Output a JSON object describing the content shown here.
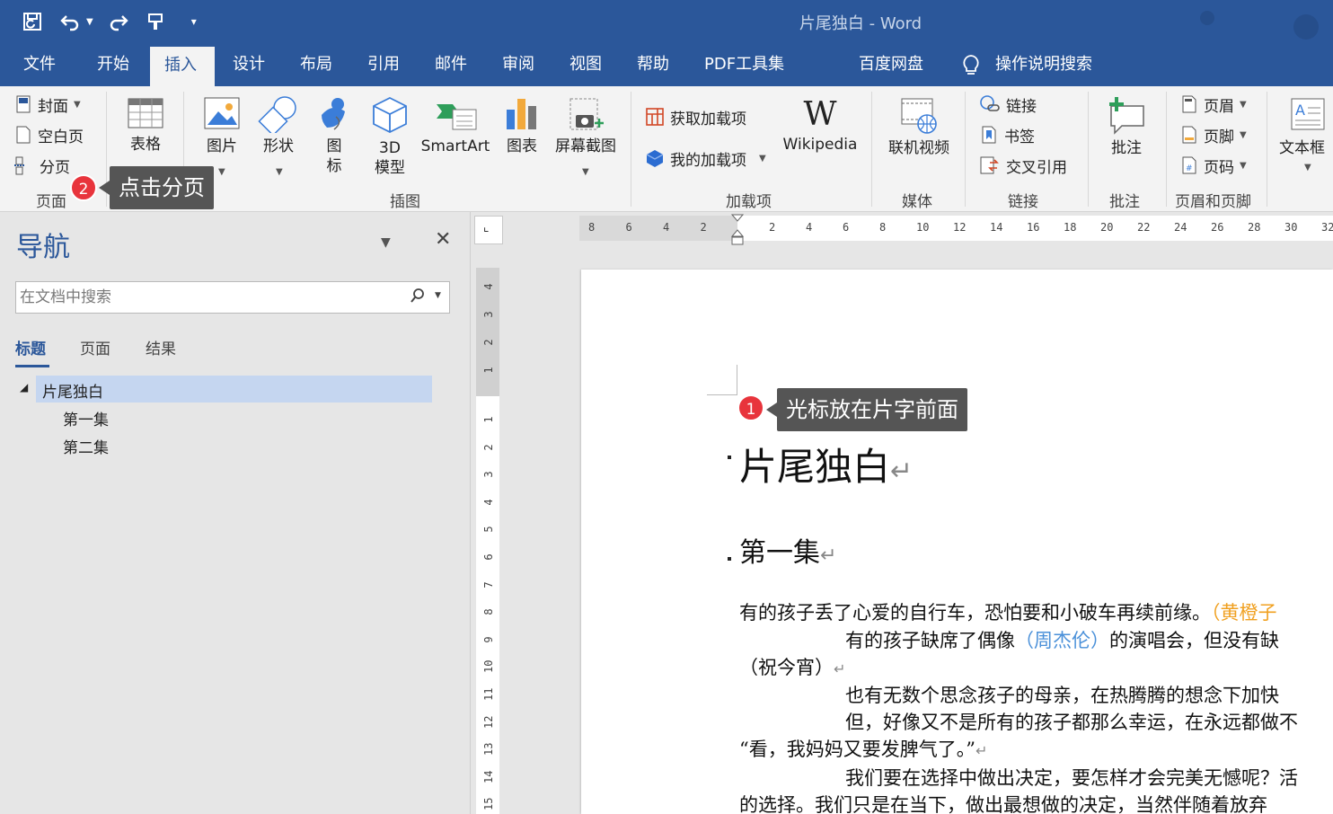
{
  "window": {
    "title": "片尾独白  -  Word"
  },
  "tabs": [
    {
      "id": "file",
      "label": "文件"
    },
    {
      "id": "home",
      "label": "开始"
    },
    {
      "id": "insert",
      "label": "插入"
    },
    {
      "id": "design",
      "label": "设计"
    },
    {
      "id": "layout",
      "label": "布局"
    },
    {
      "id": "references",
      "label": "引用"
    },
    {
      "id": "mailings",
      "label": "邮件"
    },
    {
      "id": "review",
      "label": "审阅"
    },
    {
      "id": "view",
      "label": "视图"
    },
    {
      "id": "help",
      "label": "帮助"
    },
    {
      "id": "pdf",
      "label": "PDF工具集"
    },
    {
      "id": "baidu",
      "label": "百度网盘"
    },
    {
      "id": "tellme",
      "label": "操作说明搜索"
    }
  ],
  "active_tab": "插入",
  "ribbon": {
    "pages": {
      "cover": "封面",
      "blank": "空白页",
      "break": "分页",
      "group": "页面"
    },
    "tables": {
      "table": "表格",
      "group": "表格"
    },
    "illustrations": {
      "picture": "图片",
      "shapes": "形状",
      "icons_top": "图",
      "icons_bottom": "标",
      "model_top": "3D",
      "model_bottom": "模型",
      "smartart": "SmartArt",
      "chart": "图表",
      "screenshot": "屏幕截图",
      "group": "插图"
    },
    "addins": {
      "get": "获取加载项",
      "my": "我的加载项",
      "wikipedia": "Wikipedia",
      "group": "加载项"
    },
    "media": {
      "video": "联机视频",
      "group": "媒体"
    },
    "links": {
      "link": "链接",
      "bookmark": "书签",
      "crossref": "交叉引用",
      "group": "链接"
    },
    "comments": {
      "comment": "批注",
      "group": "批注"
    },
    "header_footer": {
      "header": "页眉",
      "footer": "页脚",
      "page_number": "页码",
      "group": "页眉和页脚"
    },
    "text": {
      "textbox": "文本框"
    }
  },
  "navigation": {
    "title": "导航",
    "search_placeholder": "在文档中搜索",
    "tabs": [
      "标题",
      "页面",
      "结果"
    ],
    "tree": [
      {
        "label": "片尾独白",
        "level": 1
      },
      {
        "label": "第一集",
        "level": 2
      },
      {
        "label": "第二集",
        "level": 2
      }
    ]
  },
  "ruler": {
    "h_numbers": [
      "8",
      "6",
      "4",
      "2",
      "2",
      "4",
      "6",
      "8",
      "10",
      "12",
      "14",
      "16",
      "18",
      "20",
      "22",
      "24",
      "26",
      "28",
      "30",
      "32"
    ],
    "v_numbers": [
      "4",
      "3",
      "2",
      "1",
      "1",
      "2",
      "3",
      "4",
      "5",
      "6",
      "7",
      "8",
      "9",
      "10",
      "11",
      "12",
      "13",
      "14",
      "15"
    ]
  },
  "document": {
    "heading1": "片尾独白",
    "heading2": "第一集",
    "para_mark": "↵",
    "lines": {
      "l1a": "有的孩子丢了心爱的自行车，恐怕要和小破车再续前缘。",
      "l1b": "（黄橙子",
      "l2a": "有的孩子缺席了偶像",
      "l2b": "（周杰伦）",
      "l2c": "的演唱会，但没有缺",
      "l3": "（祝今宵）",
      "l4": "也有无数个思念孩子的母亲，在热腾腾的想念下加快",
      "l5": "但，好像又不是所有的孩子都那么幸运，在永远都做不",
      "l6": "“看，我妈妈又要发脾气了。”",
      "l7": "我们要在选择中做出决定，要怎样才会完美无憾呢？活",
      "l8": "的选择。我们只是在当下，做出最想做的决定，当然伴随着放弃"
    }
  },
  "callouts": {
    "c1": {
      "badge": "1",
      "text": "光标放在片字前面"
    },
    "c2": {
      "badge": "2",
      "text": "点击分页"
    }
  }
}
